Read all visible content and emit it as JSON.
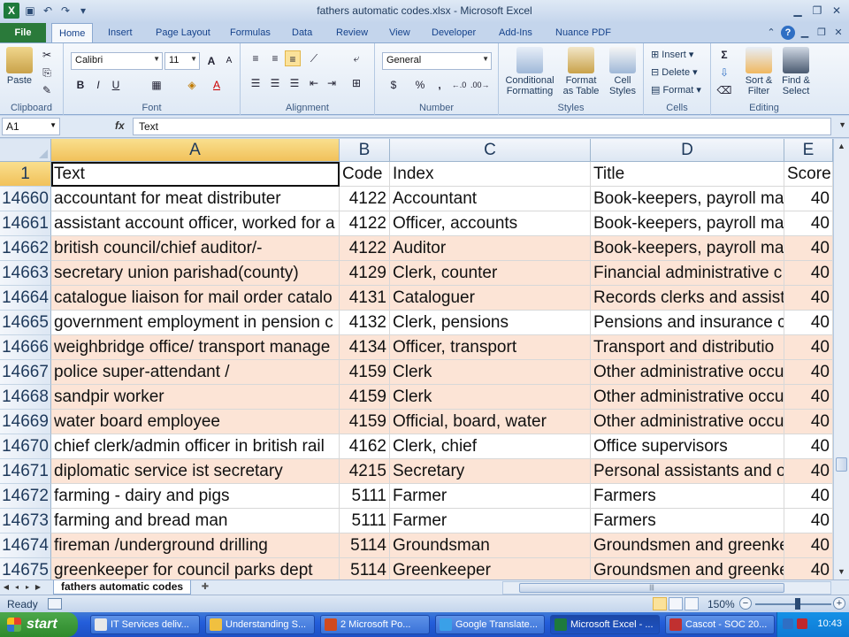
{
  "window": {
    "title": "fathers automatic codes.xlsx  -  Microsoft Excel",
    "app_icon": "X"
  },
  "ribbon_tabs": [
    "File",
    "Home",
    "Insert",
    "Page Layout",
    "Formulas",
    "Data",
    "Review",
    "View",
    "Developer",
    "Add-Ins",
    "Nuance PDF"
  ],
  "ribbon": {
    "clipboard": {
      "paste": "Paste",
      "label": "Clipboard"
    },
    "font": {
      "name": "Calibri",
      "size": "11",
      "label": "Font"
    },
    "alignment": {
      "label": "Alignment"
    },
    "number": {
      "format": "General",
      "label": "Number",
      "pct": "%",
      "comma": ","
    },
    "styles": {
      "conditional": "Conditional",
      "conditional2": "Formatting",
      "format_table": "Format",
      "format_table2": "as Table",
      "cell_styles": "Cell",
      "cell_styles2": "Styles",
      "label": "Styles"
    },
    "cells": {
      "insert": "Insert",
      "delete": "Delete",
      "format": "Format",
      "label": "Cells"
    },
    "editing": {
      "sum": "Σ",
      "sort": "Sort &",
      "sort2": "Filter",
      "find": "Find &",
      "find2": "Select",
      "label": "Editing"
    }
  },
  "formula_bar": {
    "name_box": "A1",
    "fx": "fx",
    "content": "Text"
  },
  "grid": {
    "columns": [
      "A",
      "B",
      "C",
      "D",
      "E"
    ],
    "header_row": {
      "row": "1",
      "cells": [
        "Text",
        "Code",
        "Index",
        "Title",
        "Score"
      ]
    },
    "rows": [
      {
        "row": "14660",
        "cells": [
          "accountant for meat distributer",
          "4122",
          "Accountant",
          "Book-keepers, payroll ma",
          "40"
        ]
      },
      {
        "row": "14661",
        "cells": [
          "assistant account officer, worked for a",
          "4122",
          "Officer, accounts",
          "Book-keepers, payroll ma",
          "40"
        ]
      },
      {
        "row": "14662",
        "cells": [
          "british council/chief auditor/-",
          "4122",
          "Auditor",
          "Book-keepers, payroll ma",
          "40"
        ]
      },
      {
        "row": "14663",
        "cells": [
          "secretary union parishad(county)",
          "4129",
          "Clerk, counter",
          "Financial administrative c",
          "40"
        ]
      },
      {
        "row": "14664",
        "cells": [
          "catalogue liaison for mail order catalo",
          "4131",
          "Cataloguer",
          "Records clerks and assista",
          "40"
        ]
      },
      {
        "row": "14665",
        "cells": [
          "government employment in pension c",
          "4132",
          "Clerk, pensions",
          "Pensions and insurance c",
          "40"
        ]
      },
      {
        "row": "14666",
        "cells": [
          "weighbridge office/ transport manage",
          "4134",
          "Officer, transport",
          "Transport and distributio",
          "40"
        ]
      },
      {
        "row": "14667",
        "cells": [
          "police super-attendant /",
          "4159",
          "Clerk",
          "Other administrative occu",
          "40"
        ]
      },
      {
        "row": "14668",
        "cells": [
          "sandpir worker",
          "4159",
          "Clerk",
          "Other administrative occu",
          "40"
        ]
      },
      {
        "row": "14669",
        "cells": [
          "water board employee",
          "4159",
          "Official, board, water",
          "Other administrative occu",
          "40"
        ]
      },
      {
        "row": "14670",
        "cells": [
          "chief clerk/admin officer in british rail",
          "4162",
          "Clerk, chief",
          "Office supervisors",
          "40"
        ]
      },
      {
        "row": "14671",
        "cells": [
          "diplomatic service  ist secretary",
          "4215",
          "Secretary",
          "Personal assistants and o",
          "40"
        ]
      },
      {
        "row": "14672",
        "cells": [
          "farming - dairy and pigs",
          "5111",
          "Farmer",
          "Farmers",
          "40"
        ]
      },
      {
        "row": "14673",
        "cells": [
          "farming and bread man",
          "5111",
          "Farmer",
          "Farmers",
          "40"
        ]
      },
      {
        "row": "14674",
        "cells": [
          "fireman /underground drilling",
          "5114",
          "Groundsman",
          "Groundsmen and greenke",
          "40"
        ]
      },
      {
        "row": "14675",
        "cells": [
          "greenkeeper for council parks dept",
          "5114",
          "Greenkeeper",
          "Groundsmen and greenke",
          "40"
        ]
      }
    ],
    "band_color": "#fce4d6"
  },
  "sheet_tab": "fathers automatic codes",
  "status": {
    "ready": "Ready",
    "zoom": "150%"
  },
  "taskbar": {
    "start": "start",
    "tasks": [
      "IT Services deliv...",
      "Understanding S...",
      "2 Microsoft Po...",
      "Google Translate...",
      "Microsoft Excel - ...",
      "Cascot - SOC 20..."
    ],
    "clock": "10:43"
  }
}
